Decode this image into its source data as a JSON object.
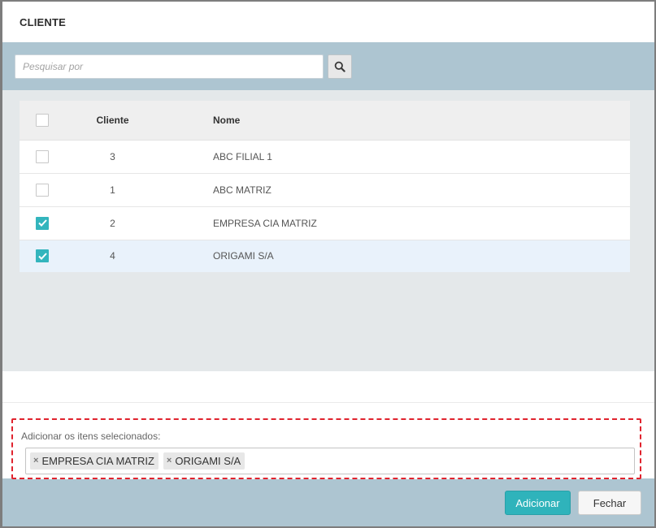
{
  "modal": {
    "title": "CLIENTE"
  },
  "search": {
    "placeholder": "Pesquisar por",
    "value": ""
  },
  "table": {
    "columns": {
      "id": "Cliente",
      "name": "Nome"
    },
    "rows": [
      {
        "id": "3",
        "name": "ABC FILIAL 1",
        "checked": false
      },
      {
        "id": "1",
        "name": "ABC MATRIZ",
        "checked": false
      },
      {
        "id": "2",
        "name": "EMPRESA CIA MATRIZ",
        "checked": true
      },
      {
        "id": "4",
        "name": "ORIGAMI S/A",
        "checked": true
      }
    ]
  },
  "selected": {
    "label": "Adicionar os itens selecionados:",
    "tags": [
      "EMPRESA CIA MATRIZ",
      "ORIGAMI S/A"
    ],
    "remove_glyph": "×"
  },
  "footer": {
    "add_label": "Adicionar",
    "close_label": "Fechar"
  },
  "colors": {
    "accent": "#2fb3bb",
    "header_band": "#adc5d1",
    "highlight_border": "#e0232e",
    "selected_row": "#e9f2fb"
  },
  "icons": {
    "search": "search-icon",
    "check": "check-icon",
    "remove": "close-icon"
  }
}
